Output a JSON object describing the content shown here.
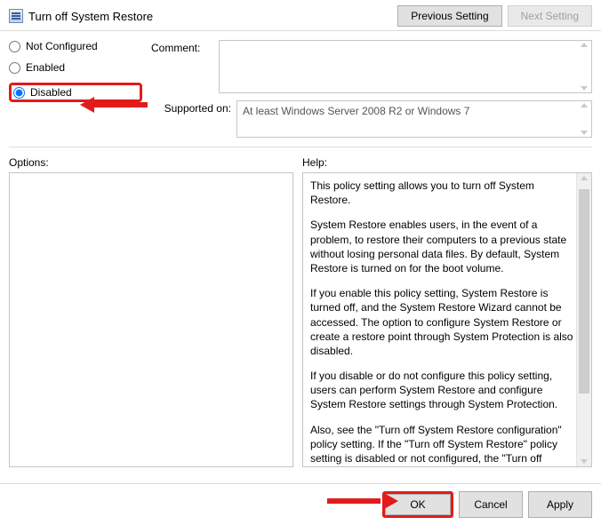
{
  "header": {
    "title": "Turn off System Restore",
    "prev_label": "Previous Setting",
    "next_label": "Next Setting"
  },
  "radios": {
    "not_configured": "Not Configured",
    "enabled": "Enabled",
    "disabled": "Disabled",
    "selected": "Disabled"
  },
  "labels": {
    "comment": "Comment:",
    "supported": "Supported on:",
    "options": "Options:",
    "help": "Help:"
  },
  "supported_text": "At least Windows Server 2008 R2 or Windows 7",
  "help_paragraphs": [
    "This policy setting allows you to turn off System Restore.",
    "System Restore enables users, in the event of a problem, to restore their computers to a previous state without losing personal data files. By default, System Restore is turned on for the boot volume.",
    "If you enable this policy setting, System Restore is turned off, and the System Restore Wizard cannot be accessed. The option to configure System Restore or create a restore point through System Protection is also disabled.",
    "If you disable or do not configure this policy setting, users can perform System Restore and configure System Restore settings through System Protection.",
    "Also, see the \"Turn off System Restore configuration\" policy setting. If the \"Turn off System Restore\" policy setting is disabled or not configured, the \"Turn off System Restore configuration\" policy setting is used to determine whether the option to configure System Restore is available."
  ],
  "footer": {
    "ok": "OK",
    "cancel": "Cancel",
    "apply": "Apply"
  }
}
